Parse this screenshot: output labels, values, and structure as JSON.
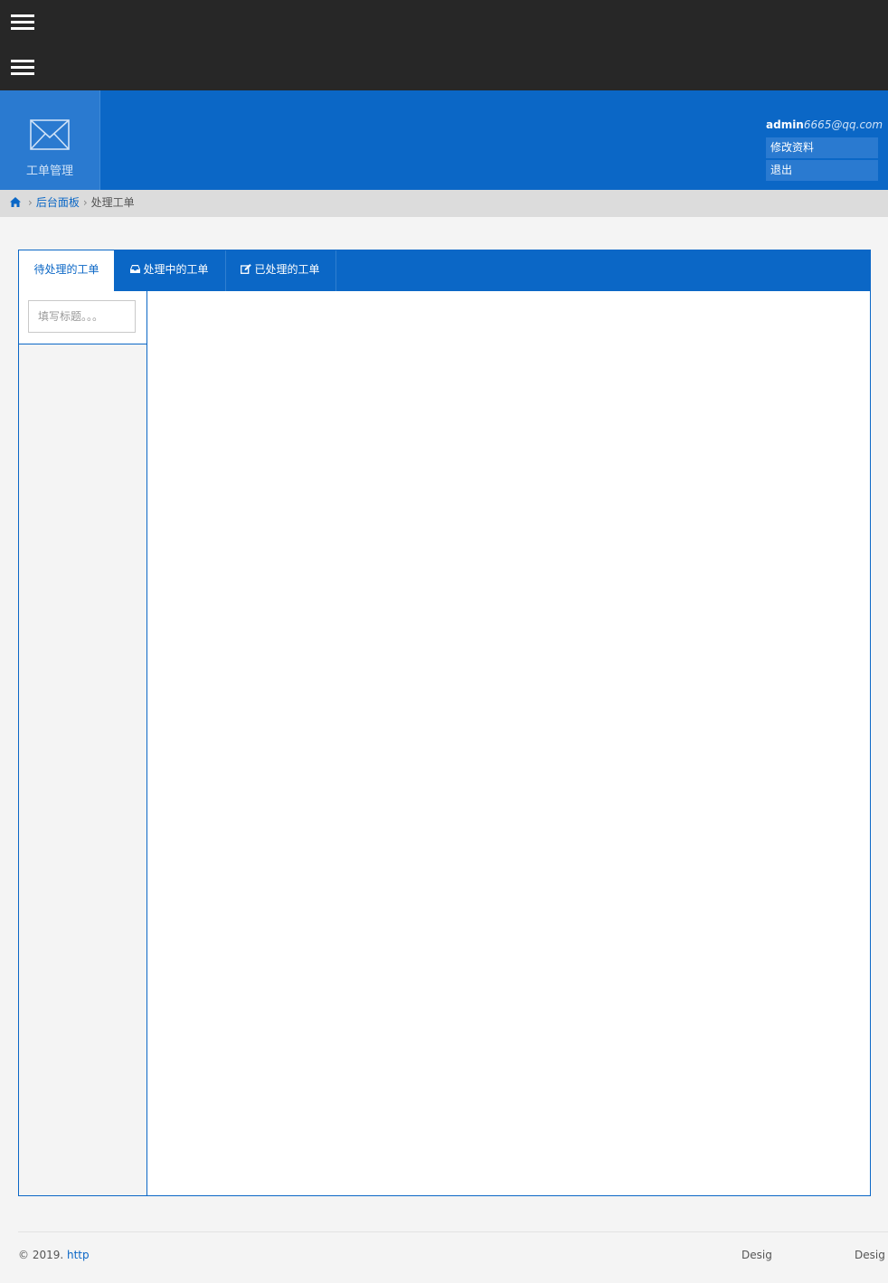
{
  "topbar": {
    "menu_icon_1": "hamburger-icon",
    "menu_icon_2": "hamburger-icon"
  },
  "header": {
    "nav_tile": {
      "icon": "envelope-icon",
      "label": "工单管理"
    },
    "user": {
      "name": "admin",
      "email": "6665@qq.com",
      "menu": [
        "修改资料",
        "退出"
      ]
    }
  },
  "breadcrumb": {
    "home_icon": "home-icon",
    "items": [
      "后台面板",
      "处理工单"
    ]
  },
  "tabs": [
    {
      "label": "待处理的工单",
      "icon": ""
    },
    {
      "label": "处理中的工单",
      "icon": "inbox-icon"
    },
    {
      "label": "已处理的工单",
      "icon": "edit-icon"
    }
  ],
  "sidebar": {
    "search_placeholder": "填写标题。。。"
  },
  "footer": {
    "copyright": "© 2019. ",
    "link": "http",
    "mid": "Desig",
    "right": "Desig"
  },
  "colors": {
    "primary": "#0b67c6",
    "topbar": "#272727",
    "tile": "#2a7ad0",
    "breadcrumb_bg": "#dcdcdc"
  }
}
